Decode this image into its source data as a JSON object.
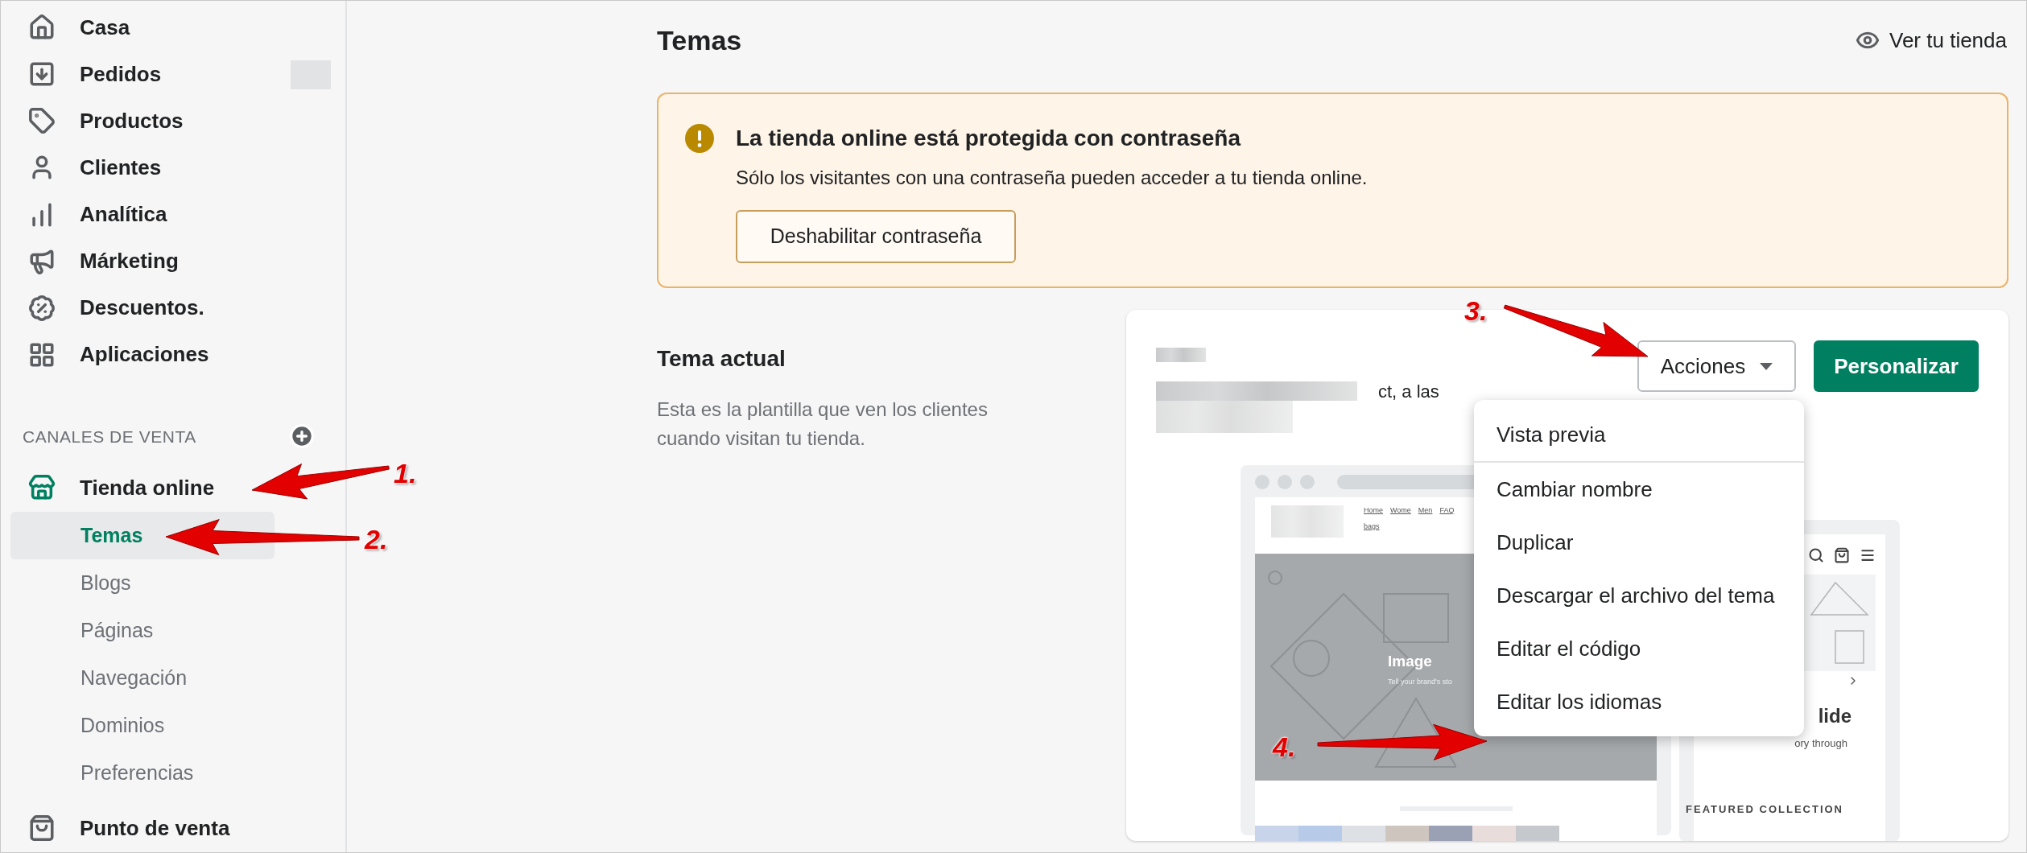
{
  "sidebar": {
    "items": [
      {
        "label": "Casa"
      },
      {
        "label": "Pedidos",
        "redacted_badge": true
      },
      {
        "label": "Productos"
      },
      {
        "label": "Clientes"
      },
      {
        "label": "Analítica"
      },
      {
        "label": "Márketing"
      },
      {
        "label": "Descuentos."
      },
      {
        "label": "Aplicaciones"
      }
    ],
    "channels_heading": "CANALES DE VENTA",
    "channels": [
      {
        "label": "Tienda online",
        "children": [
          {
            "label": "Temas",
            "selected": true
          },
          {
            "label": "Blogs",
            "selected": false
          },
          {
            "label": "Páginas",
            "selected": false
          },
          {
            "label": "Navegación",
            "selected": false
          },
          {
            "label": "Dominios",
            "selected": false
          },
          {
            "label": "Preferencias",
            "selected": false
          }
        ]
      },
      {
        "label": "Punto de venta"
      }
    ]
  },
  "page_title": "Temas",
  "view_store": "Ver tu tienda",
  "banner": {
    "title": "La tienda online está protegida con contraseña",
    "text": "Sólo los visitantes con una contraseña pueden acceder a tu tienda online.",
    "button": "Deshabilitar contraseña"
  },
  "current_theme": {
    "heading": "Tema actual",
    "description": "Esta es la plantilla que ven los clientes cuando visitan tu tienda.",
    "partial_text": "ct, a las",
    "actions_button": "Acciones",
    "customize_button": "Personalizar",
    "menu": [
      {
        "label": "Vista previa",
        "divider_after": true
      },
      {
        "label": "Cambiar nombre",
        "divider_after": false
      },
      {
        "label": "Duplicar",
        "divider_after": false
      },
      {
        "label": "Descargar el archivo del tema",
        "divider_after": false
      },
      {
        "label": "Editar el código",
        "divider_after": false
      },
      {
        "label": "Editar los idiomas",
        "divider_after": false
      }
    ],
    "preview": {
      "nav_links": [
        "Home",
        "Wome",
        "Men",
        "FAQ",
        "bags"
      ],
      "hero_title": "Image",
      "hero_text": "Tell your brand's sto",
      "mobile_title": "lide",
      "mobile_text": "ory through",
      "mobile_section": "FEATURED COLLECTION"
    }
  },
  "annotations": [
    {
      "label": "1."
    },
    {
      "label": "2."
    },
    {
      "label": "3."
    },
    {
      "label": "4."
    }
  ]
}
